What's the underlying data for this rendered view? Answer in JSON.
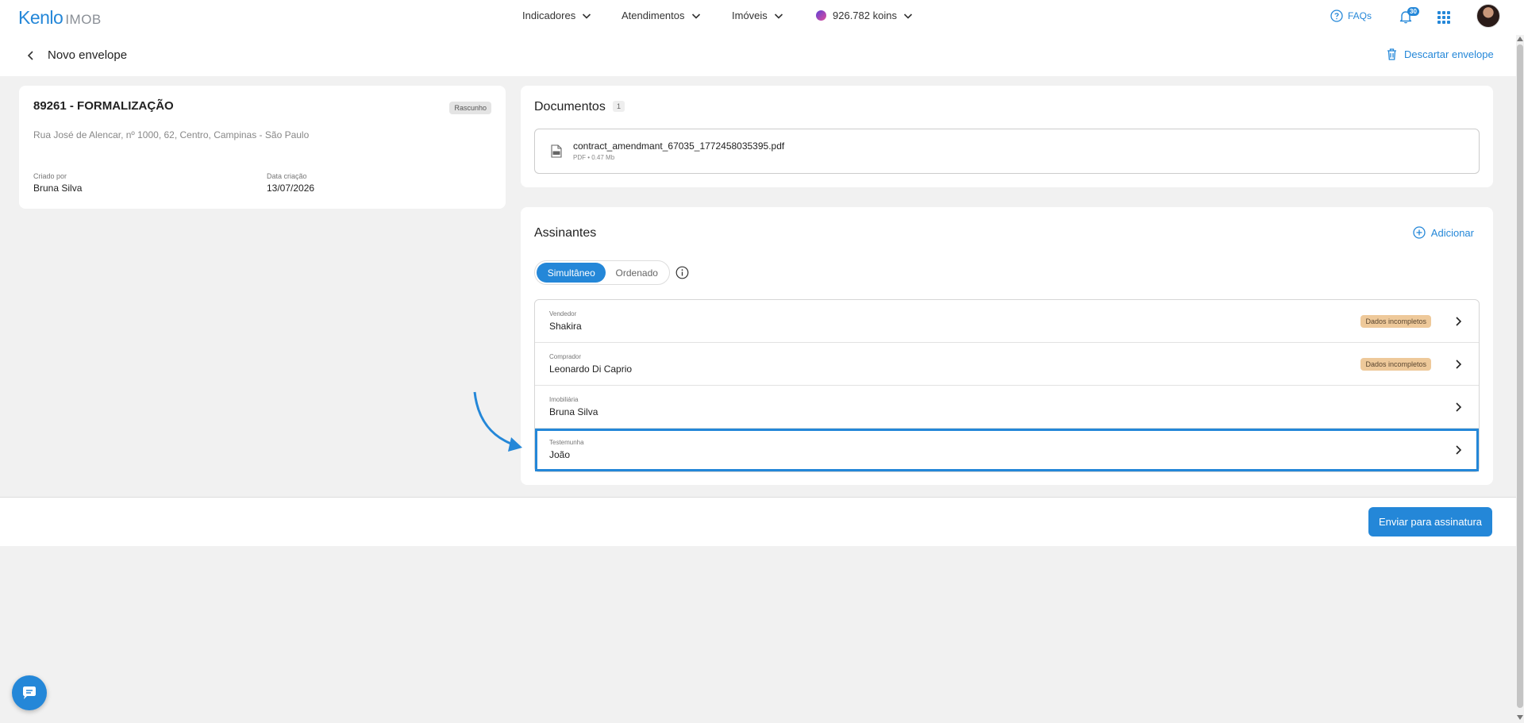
{
  "header": {
    "logo_main": "Kenlo",
    "logo_sub": "IMOB",
    "nav": [
      {
        "label": "Indicadores"
      },
      {
        "label": "Atendimentos"
      },
      {
        "label": "Imóveis"
      }
    ],
    "koins": "926.782 koins",
    "faq_label": "FAQs",
    "notifications_count": "30"
  },
  "subheader": {
    "title": "Novo envelope",
    "discard_label": "Descartar envelope"
  },
  "envelope": {
    "title": "89261 - FORMALIZAÇÃO",
    "status": "Rascunho",
    "address": "Rua José de Alencar, nº 1000, 62, Centro, Campinas - São Paulo",
    "created_by_label": "Criado por",
    "created_by": "Bruna Silva",
    "created_date_label": "Data criação",
    "created_date": "13/07/2026"
  },
  "documents": {
    "title": "Documentos",
    "count": "1",
    "items": [
      {
        "name": "contract_amendmant_67035_1772458035395.pdf",
        "meta": "PDF • 0.47 Mb"
      }
    ]
  },
  "signers": {
    "title": "Assinantes",
    "add_label": "Adicionar",
    "mode_options": [
      "Simultâneo",
      "Ordenado"
    ],
    "mode_selected": "Simultâneo",
    "rows": [
      {
        "role": "Vendedor",
        "name": "Shakira",
        "badge": "Dados incompletos"
      },
      {
        "role": "Comprador",
        "name": "Leonardo Di Caprio",
        "badge": "Dados incompletos"
      },
      {
        "role": "Imobiliária",
        "name": "Bruna Silva",
        "badge": ""
      },
      {
        "role": "Testemunha",
        "name": "João",
        "badge": ""
      }
    ]
  },
  "footer": {
    "send_label": "Enviar para assinatura"
  },
  "colors": {
    "accent": "#2487d8",
    "warning_badge": "#eec99a",
    "background": "#f1f1f1"
  }
}
